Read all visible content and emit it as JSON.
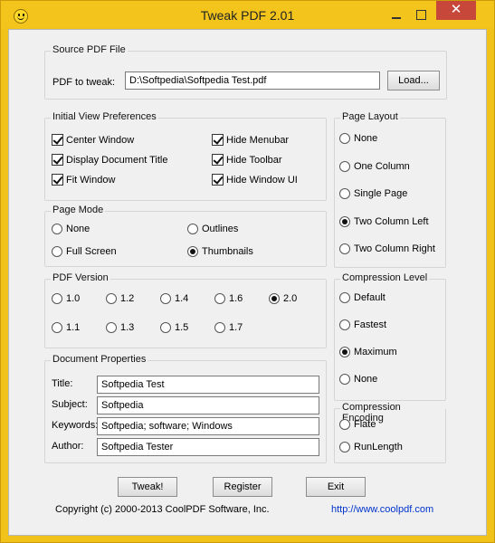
{
  "window": {
    "title": "Tweak PDF 2.01",
    "close_glyph": "✕"
  },
  "source": {
    "group_title": "Source PDF File",
    "pdf_label": "PDF to tweak:",
    "pdf_value": "D:\\Softpedia\\Softpedia Test.pdf",
    "load_label": "Load..."
  },
  "initial_view": {
    "group_title": "Initial View Preferences",
    "options": [
      {
        "label": "Center Window",
        "checked": true
      },
      {
        "label": "Display Document Title",
        "checked": true
      },
      {
        "label": "Fit Window",
        "checked": true
      },
      {
        "label": "Hide Menubar",
        "checked": true
      },
      {
        "label": "Hide Toolbar",
        "checked": true
      },
      {
        "label": "Hide Window UI",
        "checked": true
      }
    ]
  },
  "page_mode": {
    "group_title": "Page Mode",
    "options": [
      {
        "label": "None",
        "selected": false
      },
      {
        "label": "Outlines",
        "selected": false
      },
      {
        "label": "Full Screen",
        "selected": false
      },
      {
        "label": "Thumbnails",
        "selected": true
      }
    ]
  },
  "pdf_version": {
    "group_title": "PDF Version",
    "options": [
      {
        "label": "1.0",
        "selected": false
      },
      {
        "label": "1.2",
        "selected": false
      },
      {
        "label": "1.4",
        "selected": false
      },
      {
        "label": "1.6",
        "selected": false
      },
      {
        "label": "2.0",
        "selected": true
      },
      {
        "label": "1.1",
        "selected": false
      },
      {
        "label": "1.3",
        "selected": false
      },
      {
        "label": "1.5",
        "selected": false
      },
      {
        "label": "1.7",
        "selected": false
      }
    ]
  },
  "doc_props": {
    "group_title": "Document Properties",
    "fields": [
      {
        "label": "Title:",
        "value": "Softpedia Test"
      },
      {
        "label": "Subject:",
        "value": "Softpedia"
      },
      {
        "label": "Keywords:",
        "value": "Softpedia; software; Windows"
      },
      {
        "label": "Author:",
        "value": "Softpedia Tester"
      }
    ]
  },
  "page_layout": {
    "group_title": "Page Layout",
    "options": [
      {
        "label": "None",
        "selected": false
      },
      {
        "label": "One Column",
        "selected": false
      },
      {
        "label": "Single Page",
        "selected": false
      },
      {
        "label": "Two Column Left",
        "selected": true
      },
      {
        "label": "Two Column Right",
        "selected": false
      }
    ]
  },
  "compression_level": {
    "group_title": "Compression Level",
    "options": [
      {
        "label": "Default",
        "selected": false
      },
      {
        "label": "Fastest",
        "selected": false
      },
      {
        "label": "Maximum",
        "selected": true
      },
      {
        "label": "None",
        "selected": false
      }
    ]
  },
  "compression_encoding": {
    "group_title": "Compression Encoding",
    "options": [
      {
        "label": "Flate",
        "selected": false
      },
      {
        "label": "RunLength",
        "selected": false
      }
    ]
  },
  "buttons": {
    "tweak": "Tweak!",
    "register": "Register",
    "exit": "Exit"
  },
  "footer": {
    "copyright": "Copyright (c) 2000-2013 CoolPDF Software, Inc.",
    "url": "http://www.coolpdf.com"
  }
}
